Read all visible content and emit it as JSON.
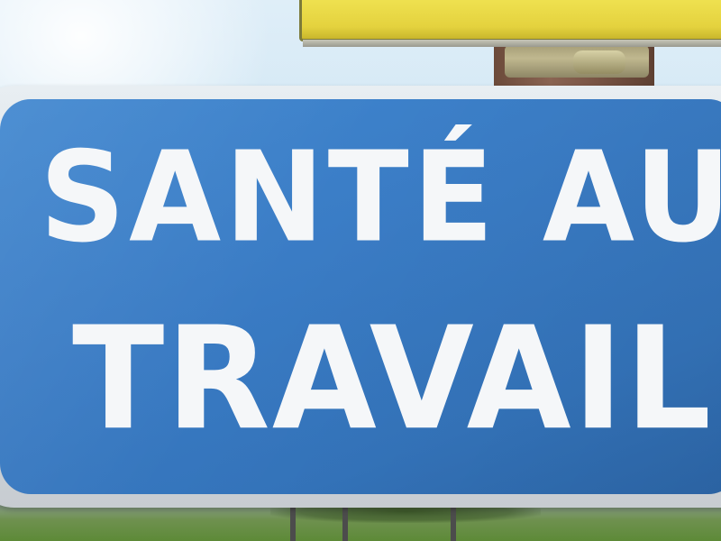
{
  "sign": {
    "line1": "SANTÉ AU",
    "line2": "TRAVAIL",
    "background_color": "#3a7cc5",
    "text_color": "#f5f7f9"
  }
}
